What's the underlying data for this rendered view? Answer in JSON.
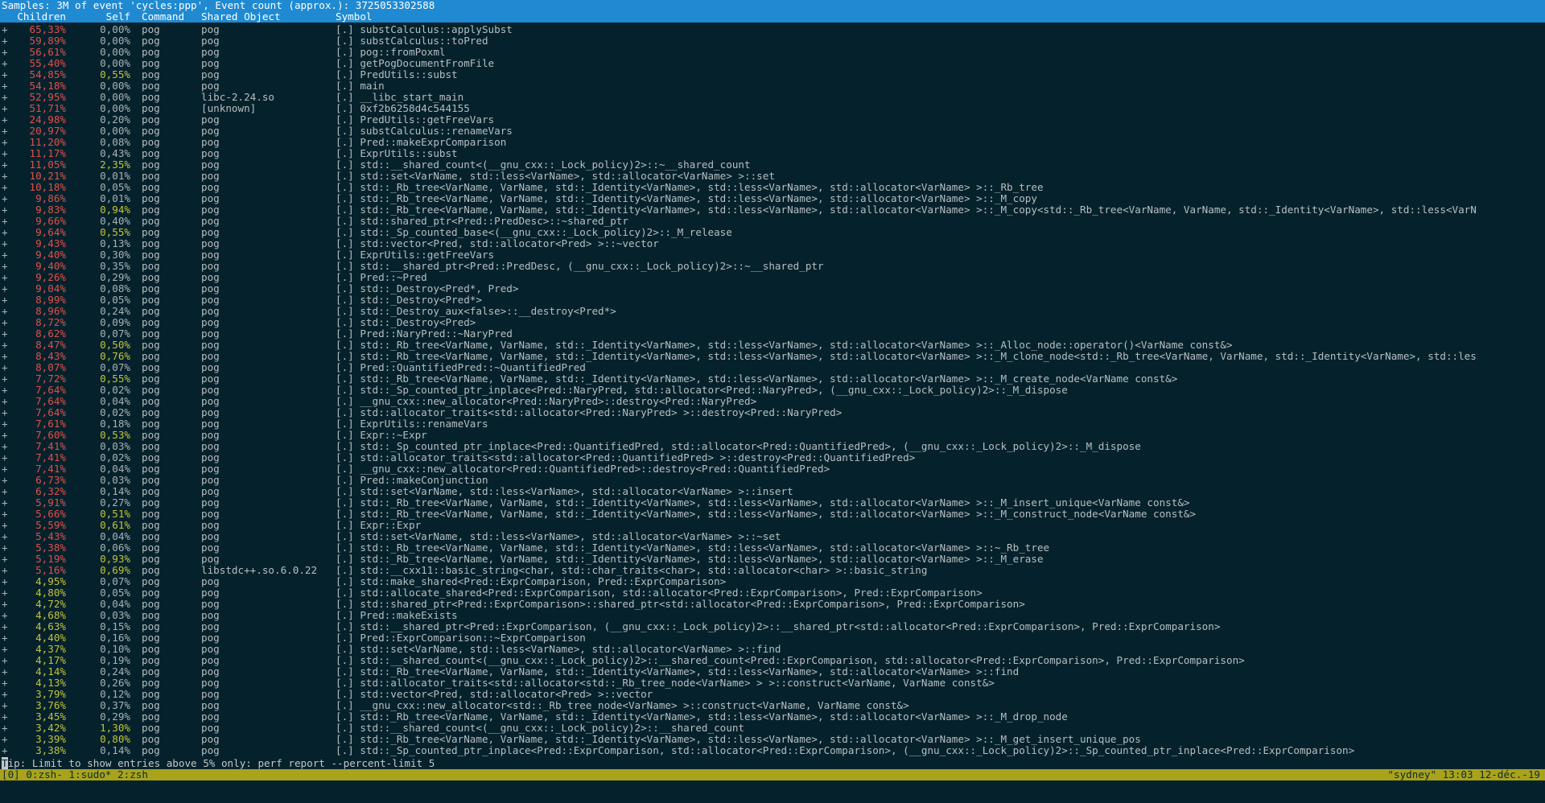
{
  "header": {
    "title": "Samples: 3M of event 'cycles:ppp', Event count (approx.): 3725053302588"
  },
  "columns": {
    "children": "Children",
    "self": "Self",
    "command": "Command",
    "shared_object": "Shared Object",
    "symbol": "Symbol"
  },
  "colors": {
    "high": "#e0504a",
    "medium": "#c4c13a",
    "low": "#a8b1b3",
    "header_bg": "#1f8ad2",
    "status_bg": "#a8a31a"
  },
  "rows": [
    {
      "children": "65,33%",
      "self": "0,00%",
      "command": "pog",
      "so": "pog",
      "symbol": "[.] substCalculus::applySubst"
    },
    {
      "children": "59,89%",
      "self": "0,00%",
      "command": "pog",
      "so": "pog",
      "symbol": "[.] substCalculus::toPred"
    },
    {
      "children": "56,61%",
      "self": "0,00%",
      "command": "pog",
      "so": "pog",
      "symbol": "[.] pog::fromPoxml"
    },
    {
      "children": "55,40%",
      "self": "0,00%",
      "command": "pog",
      "so": "pog",
      "symbol": "[.] getPogDocumentFromFile"
    },
    {
      "children": "54,85%",
      "self": "0,55%",
      "command": "pog",
      "so": "pog",
      "symbol": "[.] PredUtils::subst"
    },
    {
      "children": "54,18%",
      "self": "0,00%",
      "command": "pog",
      "so": "pog",
      "symbol": "[.] main"
    },
    {
      "children": "52,95%",
      "self": "0,00%",
      "command": "pog",
      "so": "libc-2.24.so",
      "symbol": "[.] __libc_start_main"
    },
    {
      "children": "51,71%",
      "self": "0,00%",
      "command": "pog",
      "so": "[unknown]",
      "symbol": "[.] 0xf2b6258d4c544155"
    },
    {
      "children": "24,98%",
      "self": "0,20%",
      "command": "pog",
      "so": "pog",
      "symbol": "[.] PredUtils::getFreeVars"
    },
    {
      "children": "20,97%",
      "self": "0,00%",
      "command": "pog",
      "so": "pog",
      "symbol": "[.] substCalculus::renameVars"
    },
    {
      "children": "11,20%",
      "self": "0,08%",
      "command": "pog",
      "so": "pog",
      "symbol": "[.] Pred::makeExprComparison"
    },
    {
      "children": "11,17%",
      "self": "0,43%",
      "command": "pog",
      "so": "pog",
      "symbol": "[.] ExprUtils::subst"
    },
    {
      "children": "11,05%",
      "self": "2,35%",
      "command": "pog",
      "so": "pog",
      "symbol": "[.] std::__shared_count<(__gnu_cxx::_Lock_policy)2>::~__shared_count"
    },
    {
      "children": "10,21%",
      "self": "0,01%",
      "command": "pog",
      "so": "pog",
      "symbol": "[.] std::set<VarName, std::less<VarName>, std::allocator<VarName> >::set"
    },
    {
      "children": "10,18%",
      "self": "0,05%",
      "command": "pog",
      "so": "pog",
      "symbol": "[.] std::_Rb_tree<VarName, VarName, std::_Identity<VarName>, std::less<VarName>, std::allocator<VarName> >::_Rb_tree"
    },
    {
      "children": "9,86%",
      "self": "0,01%",
      "command": "pog",
      "so": "pog",
      "symbol": "[.] std::_Rb_tree<VarName, VarName, std::_Identity<VarName>, std::less<VarName>, std::allocator<VarName> >::_M_copy"
    },
    {
      "children": "9,83%",
      "self": "0,94%",
      "command": "pog",
      "so": "pog",
      "symbol": "[.] std::_Rb_tree<VarName, VarName, std::_Identity<VarName>, std::less<VarName>, std::allocator<VarName> >::_M_copy<std::_Rb_tree<VarName, VarName, std::_Identity<VarName>, std::less<VarN"
    },
    {
      "children": "9,66%",
      "self": "0,40%",
      "command": "pog",
      "so": "pog",
      "symbol": "[.] std::shared_ptr<Pred::PredDesc>::~shared_ptr"
    },
    {
      "children": "9,64%",
      "self": "0,55%",
      "command": "pog",
      "so": "pog",
      "symbol": "[.] std::_Sp_counted_base<(__gnu_cxx::_Lock_policy)2>::_M_release"
    },
    {
      "children": "9,43%",
      "self": "0,13%",
      "command": "pog",
      "so": "pog",
      "symbol": "[.] std::vector<Pred, std::allocator<Pred> >::~vector"
    },
    {
      "children": "9,40%",
      "self": "0,30%",
      "command": "pog",
      "so": "pog",
      "symbol": "[.] ExprUtils::getFreeVars"
    },
    {
      "children": "9,40%",
      "self": "0,35%",
      "command": "pog",
      "so": "pog",
      "symbol": "[.] std::__shared_ptr<Pred::PredDesc, (__gnu_cxx::_Lock_policy)2>::~__shared_ptr"
    },
    {
      "children": "9,26%",
      "self": "0,29%",
      "command": "pog",
      "so": "pog",
      "symbol": "[.] Pred::~Pred"
    },
    {
      "children": "9,04%",
      "self": "0,08%",
      "command": "pog",
      "so": "pog",
      "symbol": "[.] std::_Destroy<Pred*, Pred>"
    },
    {
      "children": "8,99%",
      "self": "0,05%",
      "command": "pog",
      "so": "pog",
      "symbol": "[.] std::_Destroy<Pred*>"
    },
    {
      "children": "8,96%",
      "self": "0,24%",
      "command": "pog",
      "so": "pog",
      "symbol": "[.] std::_Destroy_aux<false>::__destroy<Pred*>"
    },
    {
      "children": "8,72%",
      "self": "0,09%",
      "command": "pog",
      "so": "pog",
      "symbol": "[.] std::_Destroy<Pred>"
    },
    {
      "children": "8,62%",
      "self": "0,07%",
      "command": "pog",
      "so": "pog",
      "symbol": "[.] Pred::NaryPred::~NaryPred"
    },
    {
      "children": "8,47%",
      "self": "0,50%",
      "command": "pog",
      "so": "pog",
      "symbol": "[.] std::_Rb_tree<VarName, VarName, std::_Identity<VarName>, std::less<VarName>, std::allocator<VarName> >::_Alloc_node::operator()<VarName const&>"
    },
    {
      "children": "8,43%",
      "self": "0,76%",
      "command": "pog",
      "so": "pog",
      "symbol": "[.] std::_Rb_tree<VarName, VarName, std::_Identity<VarName>, std::less<VarName>, std::allocator<VarName> >::_M_clone_node<std::_Rb_tree<VarName, VarName, std::_Identity<VarName>, std::les"
    },
    {
      "children": "8,07%",
      "self": "0,07%",
      "command": "pog",
      "so": "pog",
      "symbol": "[.] Pred::QuantifiedPred::~QuantifiedPred"
    },
    {
      "children": "7,72%",
      "self": "0,55%",
      "command": "pog",
      "so": "pog",
      "symbol": "[.] std::_Rb_tree<VarName, VarName, std::_Identity<VarName>, std::less<VarName>, std::allocator<VarName> >::_M_create_node<VarName const&>"
    },
    {
      "children": "7,64%",
      "self": "0,02%",
      "command": "pog",
      "so": "pog",
      "symbol": "[.] std::_Sp_counted_ptr_inplace<Pred::NaryPred, std::allocator<Pred::NaryPred>, (__gnu_cxx::_Lock_policy)2>::_M_dispose"
    },
    {
      "children": "7,64%",
      "self": "0,04%",
      "command": "pog",
      "so": "pog",
      "symbol": "[.] __gnu_cxx::new_allocator<Pred::NaryPred>::destroy<Pred::NaryPred>"
    },
    {
      "children": "7,64%",
      "self": "0,02%",
      "command": "pog",
      "so": "pog",
      "symbol": "[.] std::allocator_traits<std::allocator<Pred::NaryPred> >::destroy<Pred::NaryPred>"
    },
    {
      "children": "7,61%",
      "self": "0,18%",
      "command": "pog",
      "so": "pog",
      "symbol": "[.] ExprUtils::renameVars"
    },
    {
      "children": "7,60%",
      "self": "0,53%",
      "command": "pog",
      "so": "pog",
      "symbol": "[.] Expr::~Expr"
    },
    {
      "children": "7,41%",
      "self": "0,03%",
      "command": "pog",
      "so": "pog",
      "symbol": "[.] std::_Sp_counted_ptr_inplace<Pred::QuantifiedPred, std::allocator<Pred::QuantifiedPred>, (__gnu_cxx::_Lock_policy)2>::_M_dispose"
    },
    {
      "children": "7,41%",
      "self": "0,02%",
      "command": "pog",
      "so": "pog",
      "symbol": "[.] std::allocator_traits<std::allocator<Pred::QuantifiedPred> >::destroy<Pred::QuantifiedPred>"
    },
    {
      "children": "7,41%",
      "self": "0,04%",
      "command": "pog",
      "so": "pog",
      "symbol": "[.] __gnu_cxx::new_allocator<Pred::QuantifiedPred>::destroy<Pred::QuantifiedPred>"
    },
    {
      "children": "6,73%",
      "self": "0,03%",
      "command": "pog",
      "so": "pog",
      "symbol": "[.] Pred::makeConjunction"
    },
    {
      "children": "6,32%",
      "self": "0,14%",
      "command": "pog",
      "so": "pog",
      "symbol": "[.] std::set<VarName, std::less<VarName>, std::allocator<VarName> >::insert"
    },
    {
      "children": "5,91%",
      "self": "0,27%",
      "command": "pog",
      "so": "pog",
      "symbol": "[.] std::_Rb_tree<VarName, VarName, std::_Identity<VarName>, std::less<VarName>, std::allocator<VarName> >::_M_insert_unique<VarName const&>"
    },
    {
      "children": "5,66%",
      "self": "0,51%",
      "command": "pog",
      "so": "pog",
      "symbol": "[.] std::_Rb_tree<VarName, VarName, std::_Identity<VarName>, std::less<VarName>, std::allocator<VarName> >::_M_construct_node<VarName const&>"
    },
    {
      "children": "5,59%",
      "self": "0,61%",
      "command": "pog",
      "so": "pog",
      "symbol": "[.] Expr::Expr"
    },
    {
      "children": "5,43%",
      "self": "0,04%",
      "command": "pog",
      "so": "pog",
      "symbol": "[.] std::set<VarName, std::less<VarName>, std::allocator<VarName> >::~set"
    },
    {
      "children": "5,38%",
      "self": "0,06%",
      "command": "pog",
      "so": "pog",
      "symbol": "[.] std::_Rb_tree<VarName, VarName, std::_Identity<VarName>, std::less<VarName>, std::allocator<VarName> >::~_Rb_tree"
    },
    {
      "children": "5,19%",
      "self": "0,93%",
      "command": "pog",
      "so": "pog",
      "symbol": "[.] std::_Rb_tree<VarName, VarName, std::_Identity<VarName>, std::less<VarName>, std::allocator<VarName> >::_M_erase"
    },
    {
      "children": "5,16%",
      "self": "0,69%",
      "command": "pog",
      "so": "libstdc++.so.6.0.22",
      "symbol": "[.] std::__cxx11::basic_string<char, std::char_traits<char>, std::allocator<char> >::basic_string"
    },
    {
      "children": "4,95%",
      "self": "0,07%",
      "command": "pog",
      "so": "pog",
      "symbol": "[.] std::make_shared<Pred::ExprComparison, Pred::ExprComparison>"
    },
    {
      "children": "4,80%",
      "self": "0,05%",
      "command": "pog",
      "so": "pog",
      "symbol": "[.] std::allocate_shared<Pred::ExprComparison, std::allocator<Pred::ExprComparison>, Pred::ExprComparison>"
    },
    {
      "children": "4,72%",
      "self": "0,04%",
      "command": "pog",
      "so": "pog",
      "symbol": "[.] std::shared_ptr<Pred::ExprComparison>::shared_ptr<std::allocator<Pred::ExprComparison>, Pred::ExprComparison>"
    },
    {
      "children": "4,68%",
      "self": "0,03%",
      "command": "pog",
      "so": "pog",
      "symbol": "[.] Pred::makeExists"
    },
    {
      "children": "4,63%",
      "self": "0,15%",
      "command": "pog",
      "so": "pog",
      "symbol": "[.] std::__shared_ptr<Pred::ExprComparison, (__gnu_cxx::_Lock_policy)2>::__shared_ptr<std::allocator<Pred::ExprComparison>, Pred::ExprComparison>"
    },
    {
      "children": "4,40%",
      "self": "0,16%",
      "command": "pog",
      "so": "pog",
      "symbol": "[.] Pred::ExprComparison::~ExprComparison"
    },
    {
      "children": "4,37%",
      "self": "0,10%",
      "command": "pog",
      "so": "pog",
      "symbol": "[.] std::set<VarName, std::less<VarName>, std::allocator<VarName> >::find"
    },
    {
      "children": "4,17%",
      "self": "0,19%",
      "command": "pog",
      "so": "pog",
      "symbol": "[.] std::__shared_count<(__gnu_cxx::_Lock_policy)2>::__shared_count<Pred::ExprComparison, std::allocator<Pred::ExprComparison>, Pred::ExprComparison>"
    },
    {
      "children": "4,14%",
      "self": "0,24%",
      "command": "pog",
      "so": "pog",
      "symbol": "[.] std::_Rb_tree<VarName, VarName, std::_Identity<VarName>, std::less<VarName>, std::allocator<VarName> >::find"
    },
    {
      "children": "4,13%",
      "self": "0,26%",
      "command": "pog",
      "so": "pog",
      "symbol": "[.] std::allocator_traits<std::allocator<std::_Rb_tree_node<VarName> > >::construct<VarName, VarName const&>"
    },
    {
      "children": "3,79%",
      "self": "0,12%",
      "command": "pog",
      "so": "pog",
      "symbol": "[.] std::vector<Pred, std::allocator<Pred> >::vector"
    },
    {
      "children": "3,76%",
      "self": "0,37%",
      "command": "pog",
      "so": "pog",
      "symbol": "[.] __gnu_cxx::new_allocator<std::_Rb_tree_node<VarName> >::construct<VarName, VarName const&>"
    },
    {
      "children": "3,45%",
      "self": "0,29%",
      "command": "pog",
      "so": "pog",
      "symbol": "[.] std::_Rb_tree<VarName, VarName, std::_Identity<VarName>, std::less<VarName>, std::allocator<VarName> >::_M_drop_node"
    },
    {
      "children": "3,42%",
      "self": "1,30%",
      "command": "pog",
      "so": "pog",
      "symbol": "[.] std::__shared_count<(__gnu_cxx::_Lock_policy)2>::__shared_count"
    },
    {
      "children": "3,39%",
      "self": "0,80%",
      "command": "pog",
      "so": "pog",
      "symbol": "[.] std::_Rb_tree<VarName, VarName, std::_Identity<VarName>, std::less<VarName>, std::allocator<VarName> >::_M_get_insert_unique_pos"
    },
    {
      "children": "3,38%",
      "self": "0,14%",
      "command": "pog",
      "so": "pog",
      "symbol": "[.] std::_Sp_counted_ptr_inplace<Pred::ExprComparison, std::allocator<Pred::ExprComparison>, (__gnu_cxx::_Lock_policy)2>::_Sp_counted_ptr_inplace<Pred::ExprComparison>"
    }
  ],
  "expand_marker": "+",
  "tip": {
    "cursor": "T",
    "text": "ip: Limit to show entries above 5% only: perf report --percent-limit 5"
  },
  "status_bar": {
    "windows": "[0] 0:zsh- 1:sudo* 2:zsh",
    "right": "\"sydney\" 13:03 12-déc.-19"
  }
}
